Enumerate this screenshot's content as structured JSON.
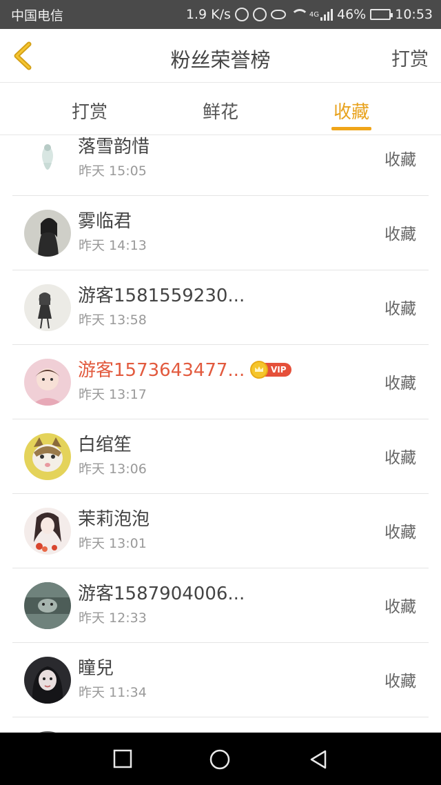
{
  "status_bar": {
    "carrier": "中国电信",
    "network_speed": "1.9 K/s",
    "network_type": "4G",
    "battery": "46%",
    "time": "10:53"
  },
  "header": {
    "title": "粉丝荣誉榜",
    "action_label": "打赏"
  },
  "tabs": [
    {
      "label": "打赏",
      "active": false
    },
    {
      "label": "鲜花",
      "active": false
    },
    {
      "label": "收藏",
      "active": true
    }
  ],
  "list": {
    "items": [
      {
        "name": "落雪韵惜",
        "time": "昨天 15:05",
        "action": "收藏",
        "vip": false
      },
      {
        "name": "雾临君",
        "time": "昨天 14:13",
        "action": "收藏",
        "vip": false
      },
      {
        "name": "游客1581559230...",
        "time": "昨天 13:58",
        "action": "收藏",
        "vip": false
      },
      {
        "name": "游客1573643477...",
        "time": "昨天 13:17",
        "action": "收藏",
        "vip": true,
        "vip_label": "VIP"
      },
      {
        "name": "白绾笙",
        "time": "昨天 13:06",
        "action": "收藏",
        "vip": false
      },
      {
        "name": "茉莉泡泡",
        "time": "昨天 13:01",
        "action": "收藏",
        "vip": false
      },
      {
        "name": "游客1587904006...",
        "time": "昨天 12:33",
        "action": "收藏",
        "vip": false
      },
      {
        "name": "瞳兒",
        "time": "昨天 11:34",
        "action": "收藏",
        "vip": false
      }
    ]
  },
  "colors": {
    "accent": "#f0a519",
    "vip_name": "#e25a3e",
    "status_bar": "#4a4a4a",
    "nav_bar": "#000000"
  }
}
